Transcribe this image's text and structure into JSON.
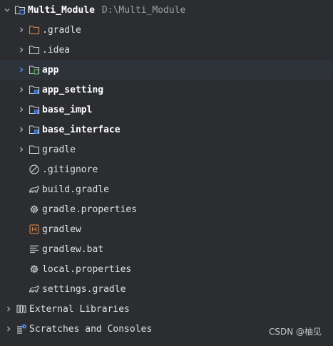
{
  "project": {
    "root_name": "Multi_Module",
    "root_path": "D:\\Multi_Module",
    "items": [
      {
        "label": ".gradle",
        "icon": "folder-icon-orange"
      },
      {
        "label": ".idea",
        "icon": "folder-icon"
      },
      {
        "label": "app",
        "icon": "module-folder-icon",
        "selected": true
      },
      {
        "label": "app_setting",
        "icon": "library-module-folder-icon"
      },
      {
        "label": "base_impl",
        "icon": "library-module-folder-icon"
      },
      {
        "label": "base_interface",
        "icon": "library-module-folder-icon"
      },
      {
        "label": "gradle",
        "icon": "folder-icon"
      },
      {
        "label": ".gitignore",
        "icon": "ignore-file-icon"
      },
      {
        "label": "build.gradle",
        "icon": "gradle-elephant-icon"
      },
      {
        "label": "gradle.properties",
        "icon": "properties-gear-icon"
      },
      {
        "label": "gradlew",
        "icon": "shell-script-icon"
      },
      {
        "label": "gradlew.bat",
        "icon": "text-file-icon"
      },
      {
        "label": "local.properties",
        "icon": "properties-gear-icon"
      },
      {
        "label": "settings.gradle",
        "icon": "gradle-elephant-icon"
      }
    ]
  },
  "external_libraries": {
    "label": "External Libraries",
    "icon": "library-icon"
  },
  "scratches": {
    "label": "Scratches and Consoles",
    "icon": "scratches-icon"
  },
  "watermark": "CSDN @柚见",
  "colors": {
    "background": "#2b2d30",
    "selected_row": "#2e3239",
    "text": "#dfe1e5",
    "accent_blue": "#4e8cf7",
    "orange": "#c97f4a",
    "green": "#57b35d"
  }
}
